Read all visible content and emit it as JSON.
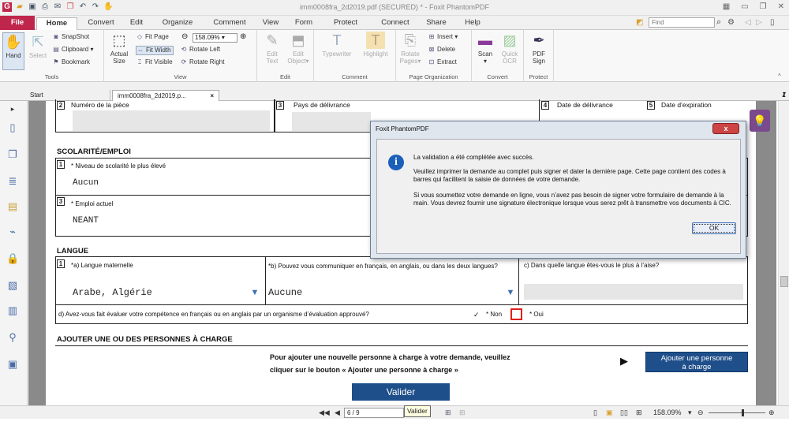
{
  "app": {
    "title": "imm0008fra_2d2019.pdf (SECURED) * - Foxit PhantomPDF"
  },
  "menu": {
    "file": "File",
    "tabs": [
      "Home",
      "Convert",
      "Edit",
      "Organize",
      "Comment",
      "View",
      "Form",
      "Protect",
      "Connect",
      "Share",
      "Help"
    ],
    "find_placeholder": "Find"
  },
  "ribbon": {
    "tools": {
      "label": "Tools",
      "hand": "Hand",
      "select": "Select",
      "snapshot": "SnapShot",
      "clipboard": "Clipboard",
      "bookmark": "Bookmark"
    },
    "view": {
      "label": "View",
      "actual_size_1": "Actual",
      "actual_size_2": "Size",
      "fit_page": "Fit Page",
      "fit_width": "Fit Width",
      "fit_visible": "Fit Visible",
      "zoom": "158.09%",
      "rotate_left": "Rotate Left",
      "rotate_right": "Rotate Right"
    },
    "edit": {
      "label": "Edit",
      "edit_text_1": "Edit",
      "edit_text_2": "Text",
      "edit_object_1": "Edit",
      "edit_object_2": "Object"
    },
    "comment": {
      "label": "Comment",
      "typewriter": "Typewriter",
      "highlight": "Highlight"
    },
    "page_org": {
      "label": "Page Organization",
      "rotate_pages_1": "Rotate",
      "rotate_pages_2": "Pages",
      "insert": "Insert",
      "delete": "Delete",
      "extract": "Extract"
    },
    "convert": {
      "label": "Convert",
      "scan": "Scan",
      "quick_ocr_1": "Quick",
      "quick_ocr_2": "OCR"
    },
    "protect": {
      "label": "Protect",
      "pdf_sign_1": "PDF",
      "pdf_sign_2": "Sign"
    }
  },
  "doctabs": {
    "start": "Start",
    "doc": "imm0008fra_2d2019.p...",
    "close": "×"
  },
  "form": {
    "row_top": {
      "n2": "2",
      "piece": "Numéro de la pièce",
      "n3": "3",
      "pays": "Pays de délivrance",
      "n4": "4",
      "date_deliv": "Date de délivrance",
      "n5": "5",
      "date_exp": "Date d’expiration"
    },
    "scolarite": {
      "title": "SCOLARITÉ/EMPLOI",
      "n1": "1",
      "niveau_label": "* Niveau de scolarité le plus élevé",
      "niveau_value": "Aucun",
      "n3": "3",
      "emploi_label": "* Emploi actuel",
      "emploi_value": "NEANT"
    },
    "langue": {
      "title": "LANGUE",
      "n1": "1",
      "maternelle_label": "*a) Langue maternelle",
      "maternelle_value": "Arabe, Algérie",
      "b_label": "*b) Pouvez vous communiquer en français, en anglais, ou dans les deux langues?",
      "b_value": "Aucune",
      "c_label": "c) Dans quelle langue êtes-vous le plus à l’aise?",
      "d_label": "d) Avez-vous fait évaluer votre compétence en français ou en anglais par un organisme d’évaluation approuvé?",
      "check": "✓",
      "non": "* Non",
      "oui": "* Oui"
    },
    "charge": {
      "title": "AJOUTER UNE OU DES PERSONNES À CHARGE",
      "text_1": "Pour ajouter une nouvelle personne à charge à votre demande, veuillez",
      "text_2": "cliquer sur le bouton « Ajouter une personne à charge »",
      "arrow": "▶",
      "button_1": "Ajouter une personne",
      "button_2": "à charge"
    },
    "valider": "Valider"
  },
  "dialog": {
    "title": "Foxit PhantomPDF",
    "close": "x",
    "icon": "i",
    "p1": "La validation a été complétée avec succès.",
    "p2": "Veuillez imprimer la demande au complet puis signer et dater la dernière page. Cette page contient des codes à barres qui facilitent la saisie de données de votre demande.",
    "p3": "Si vous soumettez votre demande en ligne, vous n’avez pas besoin de signer votre formulaire de demande à la main. Vous devrez fournir une signature électronique lorsque vous serez prêt à transmettre vos documents à CIC.",
    "ok": "OK"
  },
  "status": {
    "page": "6 / 9",
    "tooltip": "Valider",
    "zoom": "158.09%"
  }
}
